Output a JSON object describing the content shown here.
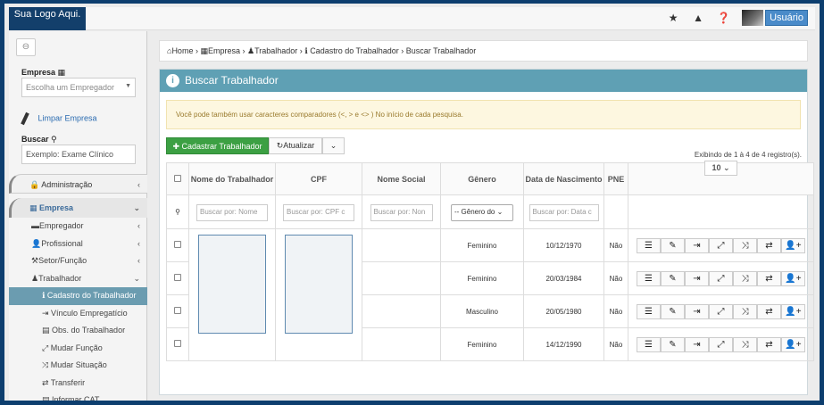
{
  "logo": {
    "text": "Sua Logo Aqui."
  },
  "topbar": {
    "icons": [
      "star-icon",
      "warning-icon",
      "question-icon"
    ],
    "user_label": "Usuário"
  },
  "sidebar": {
    "empresa_label": "Empresa",
    "empresa_placeholder": "Escolha um Empregador",
    "limpar_label": "Limpar Empresa",
    "buscar_label": "Buscar",
    "buscar_placeholder": "Exemplo: Exame Clínico",
    "menu": {
      "administracao": "Administração",
      "empresa": "Empresa",
      "empregador": "Empregador",
      "profissional": "Profissional",
      "setor": "Setor/Função",
      "trabalhador": "Trabalhador",
      "sub": [
        "Cadastro do Trabalhador",
        "Vínculo Empregatício",
        "Obs. do Trabalhador",
        "Mudar Função",
        "Mudar Situação",
        "Transferir",
        "Informar CAT"
      ]
    }
  },
  "breadcrumb": {
    "home": "Home",
    "empresa": "Empresa",
    "trabalhador": "Trabalhador",
    "cadastro": "Cadastro do Trabalhador",
    "current": "Buscar Trabalhador"
  },
  "panel": {
    "title": "Buscar Trabalhador",
    "alert": "Você pode também usar caracteres comparadores (<, > e <> ) No início de cada pesquisa.",
    "btn_cadastrar": "Cadastrar Trabalhador",
    "btn_atualizar": "Atualizar",
    "exibindo": "Exibindo de 1 à 4 de 4 registro(s).",
    "page_size": "10"
  },
  "table": {
    "headers": [
      "Nome do Trabalhador",
      "CPF",
      "Nome Social",
      "Gênero",
      "Data de Nascimento",
      "PNE"
    ],
    "filters": {
      "nome": "Buscar por: Nome",
      "cpf": "Buscar por: CPF c",
      "social": "Buscar por: Non",
      "genero": "-- Gênero do",
      "nasc": "Buscar por: Data c"
    },
    "rows": [
      {
        "genero": "Feminino",
        "nasc": "10/12/1970",
        "pne": "Não"
      },
      {
        "genero": "Feminino",
        "nasc": "20/03/1984",
        "pne": "Não"
      },
      {
        "genero": "Masculino",
        "nasc": "20/05/1980",
        "pne": "Não"
      },
      {
        "genero": "Feminino",
        "nasc": "14/12/1990",
        "pne": "Não"
      }
    ],
    "actions": [
      "list-icon",
      "edit-icon",
      "sign-in-icon",
      "expand-icon",
      "random-icon",
      "exchange-icon",
      "user-plus-icon"
    ]
  }
}
